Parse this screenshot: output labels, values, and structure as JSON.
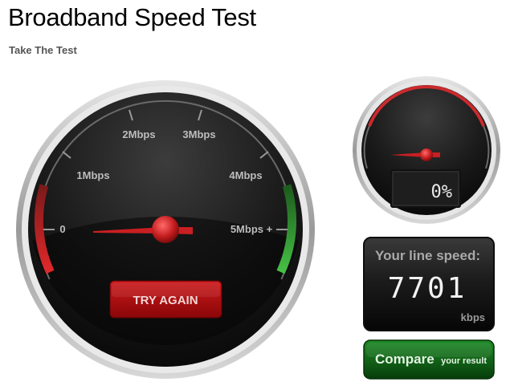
{
  "header": {
    "title": "Broadband Speed Test",
    "subtitle": "Take The Test"
  },
  "main_gauge": {
    "ticks": [
      "0",
      "1Mbps",
      "2Mbps",
      "3Mbps",
      "4Mbps",
      "5Mbps +"
    ],
    "try_again_label": "TRY AGAIN",
    "colors": {
      "low_band": "#c4262b",
      "high_band": "#3aa53a",
      "needle": "#d3262a",
      "button": "#b00d0f"
    }
  },
  "progress_gauge": {
    "percent_text": "0%",
    "progress": 0
  },
  "speed_panel": {
    "label": "Your line speed:",
    "value": "7701",
    "unit": "kbps"
  },
  "compare_button": {
    "main_label": "Compare",
    "sub_label": "your result",
    "color": "#0c6a12"
  }
}
